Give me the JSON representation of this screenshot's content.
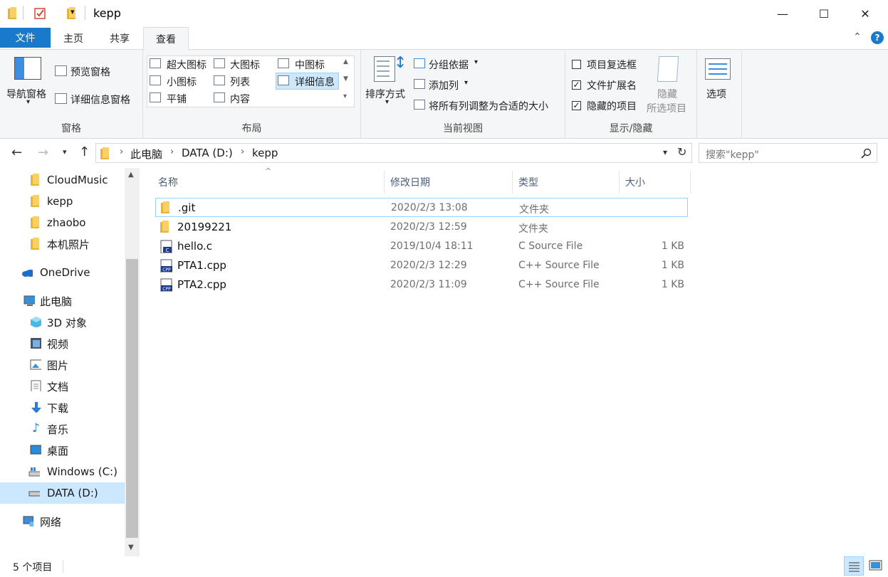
{
  "window": {
    "title": "kepp",
    "minimize": "—",
    "maximize": "☐",
    "close": "✕"
  },
  "tabs": {
    "file": "文件",
    "home": "主页",
    "share": "共享",
    "view": "查看"
  },
  "ribbon": {
    "panes": {
      "label": "窗格",
      "nav_pane": "导航窗格",
      "preview_pane": "预览窗格",
      "details_pane": "详细信息窗格"
    },
    "layout": {
      "label": "布局",
      "extra_large": "超大图标",
      "large": "大图标",
      "medium": "中图标",
      "small": "小图标",
      "list": "列表",
      "details": "详细信息",
      "tiles": "平铺",
      "content": "内容"
    },
    "current_view": {
      "label": "当前视图",
      "sort_by": "排序方式",
      "group_by": "分组依据",
      "add_columns": "添加列",
      "fit_columns": "将所有列调整为合适的大小"
    },
    "show_hide": {
      "label": "显示/隐藏",
      "item_checkboxes": "项目复选框",
      "item_checkboxes_checked": false,
      "file_extensions": "文件扩展名",
      "file_extensions_checked": true,
      "hidden_items": "隐藏的项目",
      "hidden_items_checked": true,
      "hide_selected": "隐藏",
      "hide_selected_2": "所选项目"
    },
    "options": "选项"
  },
  "address": {
    "crumbs": [
      "此电脑",
      "DATA (D:)",
      "kepp"
    ],
    "search_placeholder": "搜索\"kepp\""
  },
  "sidebar": {
    "items": [
      {
        "label": "CloudMusic",
        "icon": "folder-icon"
      },
      {
        "label": "kepp",
        "icon": "folder-icon"
      },
      {
        "label": "zhaobo",
        "icon": "folder-icon"
      },
      {
        "label": "本机照片",
        "icon": "folder-icon"
      },
      {
        "label": "OneDrive",
        "icon": "cloud-icon"
      },
      {
        "label": "此电脑",
        "icon": "computer-icon"
      },
      {
        "label": "3D 对象",
        "icon": "cube-icon"
      },
      {
        "label": "视频",
        "icon": "video-icon"
      },
      {
        "label": "图片",
        "icon": "picture-icon"
      },
      {
        "label": "文档",
        "icon": "document-icon"
      },
      {
        "label": "下载",
        "icon": "download-icon"
      },
      {
        "label": "音乐",
        "icon": "music-icon"
      },
      {
        "label": "桌面",
        "icon": "desktop-icon"
      },
      {
        "label": "Windows (C:)",
        "icon": "drive-icon"
      },
      {
        "label": "DATA (D:)",
        "icon": "drive-icon"
      },
      {
        "label": "网络",
        "icon": "network-icon"
      }
    ],
    "selected": "DATA (D:)"
  },
  "columns": {
    "name": "名称",
    "date": "修改日期",
    "type": "类型",
    "size": "大小"
  },
  "files": [
    {
      "name": ".git",
      "date": "2020/2/3 13:08",
      "type": "文件夹",
      "size": "",
      "icon": "folder-icon"
    },
    {
      "name": "20199221",
      "date": "2020/2/3 12:59",
      "type": "文件夹",
      "size": "",
      "icon": "folder-icon"
    },
    {
      "name": "hello.c",
      "date": "2019/10/4 18:11",
      "type": "C Source File",
      "size": "1 KB",
      "icon": "c-file-icon"
    },
    {
      "name": "PTA1.cpp",
      "date": "2020/2/3 12:29",
      "type": "C++ Source File",
      "size": "1 KB",
      "icon": "cpp-file-icon"
    },
    {
      "name": "PTA2.cpp",
      "date": "2020/2/3 11:09",
      "type": "C++ Source File",
      "size": "1 KB",
      "icon": "cpp-file-icon"
    }
  ],
  "status": {
    "count": "5 个项目"
  }
}
